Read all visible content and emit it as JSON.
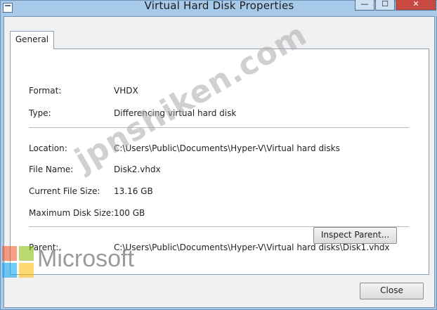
{
  "window": {
    "title": "Virtual Hard Disk Properties",
    "minimize_glyph": "—",
    "maximize_glyph": "☐",
    "close_glyph": "✕"
  },
  "tabs": [
    {
      "label": "General",
      "selected": true
    }
  ],
  "general": {
    "format": {
      "label": "Format:",
      "value": "VHDX"
    },
    "type": {
      "label": "Type:",
      "value": "Differencing virtual hard disk"
    },
    "location": {
      "label": "Location:",
      "value": "C:\\Users\\Public\\Documents\\Hyper-V\\Virtual hard disks"
    },
    "file_name": {
      "label": "File Name:",
      "value": "Disk2.vhdx"
    },
    "current_size": {
      "label": "Current File Size:",
      "value": "13.16 GB"
    },
    "max_size": {
      "label": "Maximum Disk Size:",
      "value": "100 GB"
    },
    "parent": {
      "label": "Parent:",
      "value": "C:\\Users\\Public\\Documents\\Hyper-V\\Virtual hard disks\\Disk1.vhdx"
    },
    "inspect_parent_label": "Inspect Parent..."
  },
  "footer": {
    "close_label": "Close"
  },
  "watermarks": {
    "diagonal_text": "jpnshiken.com",
    "brand_text": "Microsoft"
  },
  "colors": {
    "frame": "#a9cbec",
    "close_button": "#c7493f",
    "panel_bg": "#ffffff",
    "dialog_bg": "#f1f1f1"
  }
}
